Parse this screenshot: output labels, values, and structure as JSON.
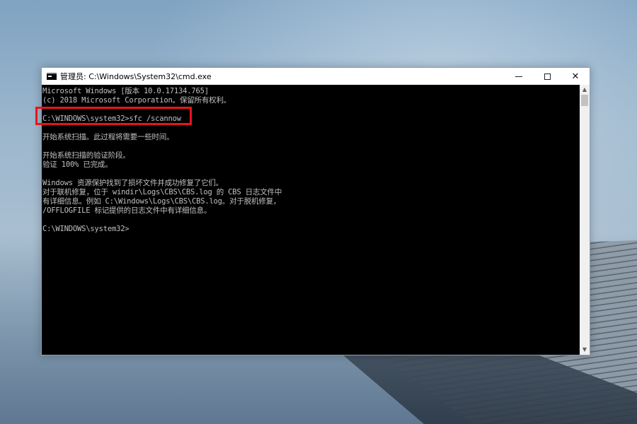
{
  "window": {
    "title": "管理员: C:\\Windows\\System32\\cmd.exe",
    "icon": "cmd-icon",
    "controls": {
      "minimize": "minimize-icon",
      "maximize": "maximize-icon",
      "close_glyph": "✕"
    }
  },
  "console": {
    "lines": [
      "Microsoft Windows [版本 10.0.17134.765]",
      "(c) 2018 Microsoft Corporation。保留所有权利。",
      "",
      "C:\\WINDOWS\\system32>sfc /scannow",
      "",
      "开始系统扫描。此过程将需要一些时间。",
      "",
      "开始系统扫描的验证阶段。",
      "验证 100% 已完成。",
      "",
      "Windows 资源保护找到了损坏文件并成功修复了它们。",
      "对于联机修复，位于 windir\\Logs\\CBS\\CBS.log 的 CBS 日志文件中",
      "有详细信息。例如 C:\\Windows\\Logs\\CBS\\CBS.log。对于脱机修复，",
      "/OFFLOGFILE 标记提供的日志文件中有详细信息。",
      "",
      "C:\\WINDOWS\\system32>"
    ],
    "highlight_color": "#e8141b",
    "text_color": "#c0c0c0",
    "background": "#000000"
  },
  "scrollbar": {
    "up_glyph": "▲",
    "down_glyph": "▼"
  }
}
